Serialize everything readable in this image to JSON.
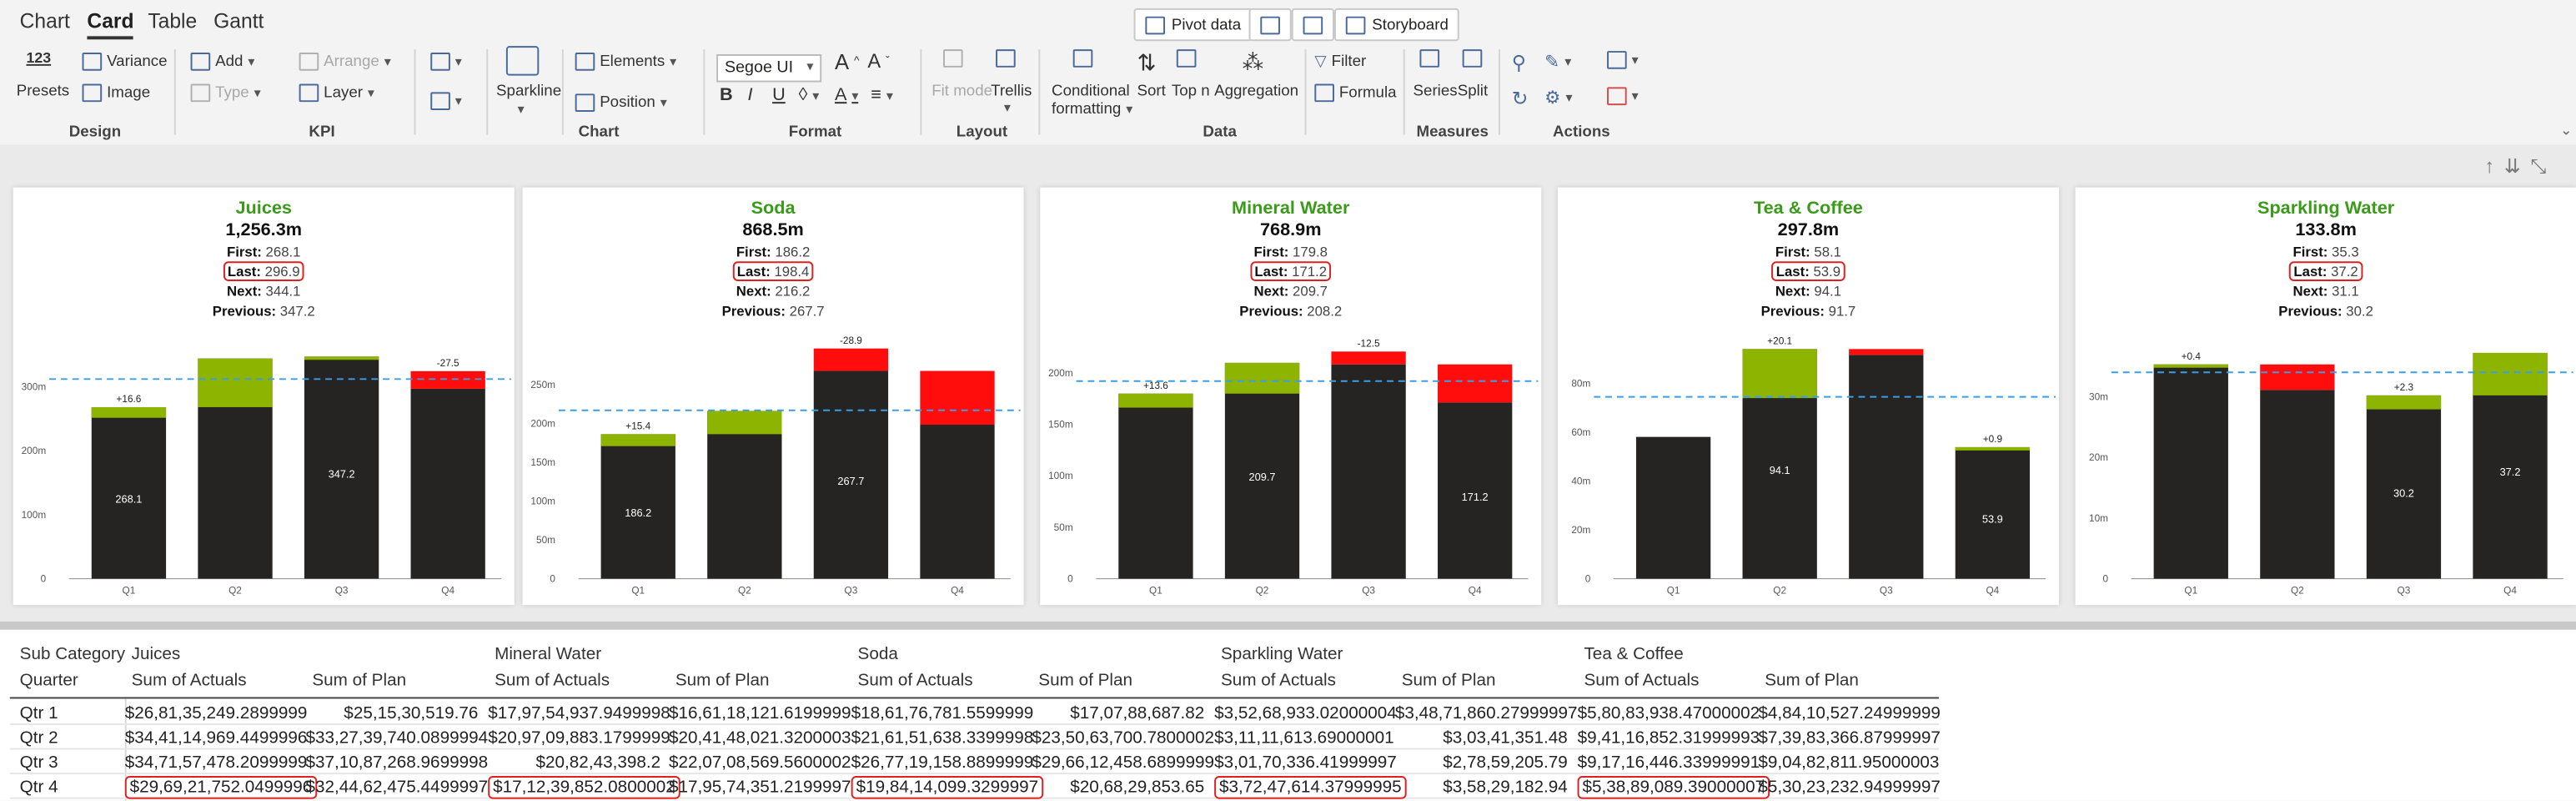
{
  "tabs": [
    {
      "label": "Chart",
      "active": false
    },
    {
      "label": "Card",
      "active": true
    },
    {
      "label": "Table",
      "active": false
    },
    {
      "label": "Gantt",
      "active": false
    }
  ],
  "top_buttons": {
    "pivot": "Pivot data",
    "storyboard": "Storyboard"
  },
  "ribbon": {
    "groups": [
      "Design",
      "KPI",
      "Chart",
      "Format",
      "Layout",
      "Data",
      "Measures",
      "Actions"
    ],
    "presets_number": "123",
    "presets": "Presets",
    "variance": "Variance",
    "image": "Image",
    "add": "Add",
    "type": "Type",
    "arrange": "Arrange",
    "layer": "Layer",
    "sparkline": "Sparkline",
    "elements": "Elements",
    "position": "Position",
    "font": "Segoe UI",
    "fit_mode": "Fit mode",
    "trellis": "Trellis",
    "conditional": "Conditional",
    "formatting": "formatting",
    "sort": "Sort",
    "topn": "Top n",
    "aggregation": "Aggregation",
    "filter": "Filter",
    "formula": "Formula",
    "series": "Series",
    "split": "Split"
  },
  "colors": {
    "title": "#3a9a1a",
    "bar": "#252423",
    "pos": "#8cb400",
    "neg": "#ff0d0d",
    "ref": "#3a9ee6",
    "highlight": "#e02020"
  },
  "cards": [
    {
      "title": "Juices",
      "total": "1,256.3m",
      "first": "268.1",
      "last": "296.9",
      "next": "344.1",
      "previous": "347.2"
    },
    {
      "title": "Soda",
      "total": "868.5m",
      "first": "186.2",
      "last": "198.4",
      "next": "216.2",
      "previous": "267.7"
    },
    {
      "title": "Mineral Water",
      "total": "768.9m",
      "first": "179.8",
      "last": "171.2",
      "next": "209.7",
      "previous": "208.2"
    },
    {
      "title": "Tea & Coffee",
      "total": "297.8m",
      "first": "58.1",
      "last": "53.9",
      "next": "94.1",
      "previous": "91.7"
    },
    {
      "title": "Sparkling Water",
      "total": "133.8m",
      "first": "35.3",
      "last": "37.2",
      "next": "31.1",
      "previous": "30.2"
    }
  ],
  "kpi_labels": {
    "first": "First:",
    "last": "Last:",
    "next": "Next:",
    "previous": "Previous:"
  },
  "chart_data": [
    {
      "type": "bar",
      "title": "Juices",
      "categories": [
        "Q1",
        "Q2",
        "Q3",
        "Q4"
      ],
      "values": [
        268.1,
        344.1,
        347.2,
        296.9
      ],
      "variance": [
        16.6,
        null,
        null,
        -27.5
      ],
      "reference": 312,
      "yticks": [
        "0",
        "100m",
        "200m",
        "300m"
      ],
      "ylim": [
        0,
        370
      ],
      "bar_labels": [
        "268.1",
        "",
        "347.2",
        ""
      ],
      "variance_labels": [
        "+16.6",
        "",
        "",
        "-27.5"
      ]
    },
    {
      "type": "bar",
      "title": "Soda",
      "categories": [
        "Q1",
        "Q2",
        "Q3",
        "Q4"
      ],
      "values": [
        186.2,
        216.2,
        267.7,
        198.4
      ],
      "variance": [
        15.4,
        null,
        -28.9,
        null
      ],
      "reference": 217,
      "yticks": [
        "0",
        "50m",
        "100m",
        "150m",
        "200m",
        "250m"
      ],
      "ylim": [
        0,
        305
      ],
      "bar_labels": [
        "186.2",
        "",
        "267.7",
        ""
      ],
      "variance_labels": [
        "+15.4",
        "",
        "-28.9",
        ""
      ]
    },
    {
      "type": "bar",
      "title": "Mineral Water",
      "categories": [
        "Q1",
        "Q2",
        "Q3",
        "Q4"
      ],
      "values": [
        179.8,
        209.7,
        208.2,
        171.2
      ],
      "variance": [
        13.6,
        null,
        -12.5,
        null
      ],
      "reference": 192,
      "yticks": [
        "0",
        "50m",
        "100m",
        "150m",
        "200m"
      ],
      "ylim": [
        0,
        230
      ],
      "bar_labels": [
        "",
        "209.7",
        "",
        "171.2"
      ],
      "variance_labels": [
        "+13.6",
        "",
        "-12.5",
        ""
      ]
    },
    {
      "type": "bar",
      "title": "Tea & Coffee",
      "categories": [
        "Q1",
        "Q2",
        "Q3",
        "Q4"
      ],
      "values": [
        58.1,
        94.1,
        91.7,
        53.9
      ],
      "variance": [
        null,
        20.1,
        null,
        0.9
      ],
      "reference": 74.5,
      "yticks": [
        "0",
        "20m",
        "40m",
        "60m",
        "80m"
      ],
      "ylim": [
        0,
        97
      ],
      "bar_labels": [
        "",
        "94.1",
        "",
        "53.9"
      ],
      "variance_labels": [
        "",
        "+20.1",
        "",
        "+0.9"
      ]
    },
    {
      "type": "bar",
      "title": "Sparkling Water",
      "categories": [
        "Q1",
        "Q2",
        "Q3",
        "Q4"
      ],
      "values": [
        35.3,
        31.1,
        30.2,
        37.2
      ],
      "variance": [
        0.4,
        null,
        2.3,
        null
      ],
      "reference": 34,
      "yticks": [
        "0",
        "10m",
        "20m",
        "30m"
      ],
      "ylim": [
        0,
        39
      ],
      "bar_labels": [
        "",
        "",
        "30.2",
        "37.2"
      ],
      "variance_labels": [
        "+0.4",
        "",
        "+2.3",
        ""
      ]
    }
  ],
  "table": {
    "row_header_1": "Sub Category",
    "row_header_2": "Quarter",
    "groups": [
      "Juices",
      "Mineral Water",
      "Soda",
      "Sparkling Water",
      "Tea & Coffee"
    ],
    "col_actuals": "Sum of Actuals",
    "col_plan": "Sum of Plan",
    "rows": [
      {
        "label": "Qtr 1",
        "cells": [
          "$26,81,35,249.2899999",
          "$25,15,30,519.76",
          "$17,97,54,937.9499998",
          "$16,61,18,121.6199999",
          "$18,61,76,781.5599999",
          "$17,07,88,687.82",
          "$3,52,68,933.02000004",
          "$3,48,71,860.27999997",
          "$5,80,83,938.47000002",
          "$4,84,10,527.24999999"
        ]
      },
      {
        "label": "Qtr 2",
        "cells": [
          "$34,41,14,969.4499996",
          "$33,27,39,740.0899994",
          "$20,97,09,883.1799999",
          "$20,41,48,021.3200003",
          "$21,61,51,638.3399998",
          "$23,50,63,700.7800002",
          "$3,11,11,613.69000001",
          "$3,03,41,351.48",
          "$9,41,16,852.31999993",
          "$7,39,83,366.87999997"
        ]
      },
      {
        "label": "Qtr 3",
        "cells": [
          "$34,71,57,478.2099999",
          "$37,10,87,268.9699998",
          "$20,82,43,398.2",
          "$22,07,08,569.5600002",
          "$26,77,19,158.8899999",
          "$29,66,12,458.6899999",
          "$3,01,70,336.41999997",
          "$2,78,59,205.79",
          "$9,17,16,446.33999991",
          "$9,04,82,811.95000003"
        ]
      },
      {
        "label": "Qtr 4",
        "cells": [
          "$29,69,21,752.0499996",
          "$32,44,62,475.4499997",
          "$17,12,39,852.0800002",
          "$17,95,74,351.2199997",
          "$19,84,14,099.3299997",
          "$20,68,29,853.65",
          "$3,72,47,614.37999995",
          "$3,58,29,182.94",
          "$5,38,89,089.39000007",
          "$5,30,23,232.94999997"
        ]
      }
    ]
  }
}
